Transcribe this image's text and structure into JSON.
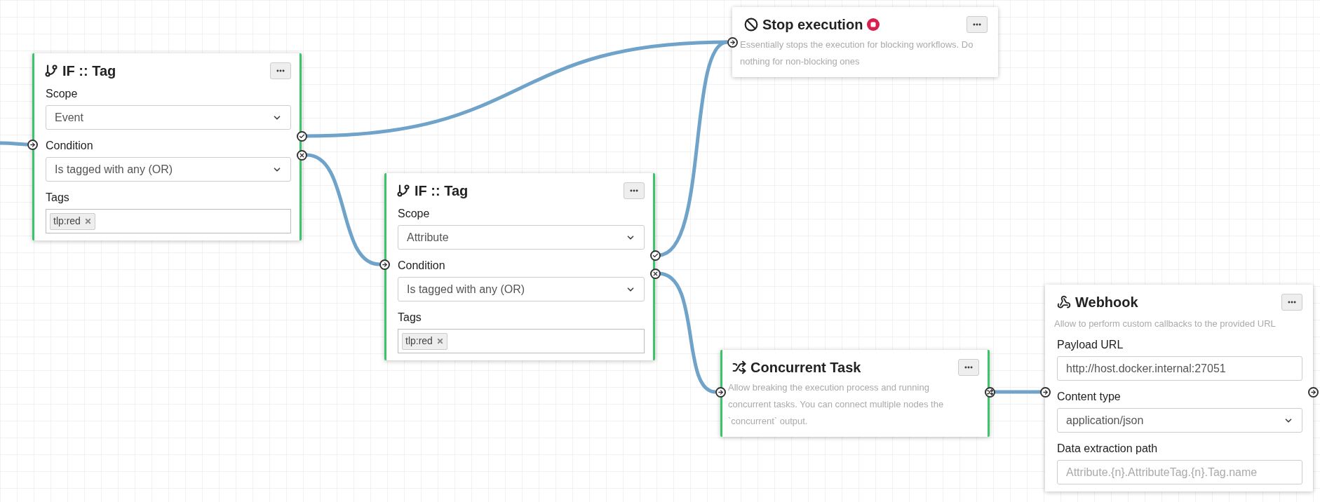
{
  "nodes": [
    {
      "kind": "stop",
      "title": "Stop execution",
      "active": false,
      "description": "Essentially stops the execution for blocking workflows. Do nothing for non-blocking ones"
    },
    {
      "kind": "if",
      "title": "IF :: Tag",
      "active": true,
      "output_ports": [
        {
          "kind": "success"
        },
        {
          "kind": "failure"
        }
      ],
      "fields": [
        {
          "kind": "select",
          "label": "Scope",
          "value": "Event"
        },
        {
          "kind": "select",
          "label": "Condition",
          "value": "Is tagged with any (OR)"
        },
        {
          "kind": "tags",
          "label": "Tags",
          "tags": [
            "tlp:red"
          ]
        }
      ]
    },
    {
      "kind": "if",
      "title": "IF :: Tag",
      "active": true,
      "output_ports": [
        {
          "kind": "success"
        },
        {
          "kind": "failure"
        }
      ],
      "fields": [
        {
          "kind": "select",
          "label": "Scope",
          "value": "Attribute"
        },
        {
          "kind": "select",
          "label": "Condition",
          "value": "Is tagged with any (OR)"
        },
        {
          "kind": "tags",
          "label": "Tags",
          "tags": [
            "tlp:red"
          ]
        }
      ]
    },
    {
      "kind": "concurrent",
      "title": "Concurrent Task",
      "active": true,
      "description": "Allow breaking the execution process and running concurrent tasks. You can connect multiple nodes the `concurrent` output.",
      "output_ports": [
        {
          "kind": "concurrent"
        }
      ]
    },
    {
      "kind": "webhook",
      "title": "Webhook",
      "active": false,
      "description": "Allow to perform custom callbacks to the provided URL",
      "output_ports": [
        {
          "kind": "default"
        }
      ],
      "fields": [
        {
          "kind": "text",
          "label": "Payload URL",
          "value": "http://host.docker.internal:27051"
        },
        {
          "kind": "select",
          "label": "Content type",
          "value": "application/json"
        },
        {
          "kind": "text",
          "label": "Data extraction path",
          "placeholder": "Attribute.{n}.AttributeTag.{n}.Tag.name"
        }
      ]
    }
  ]
}
